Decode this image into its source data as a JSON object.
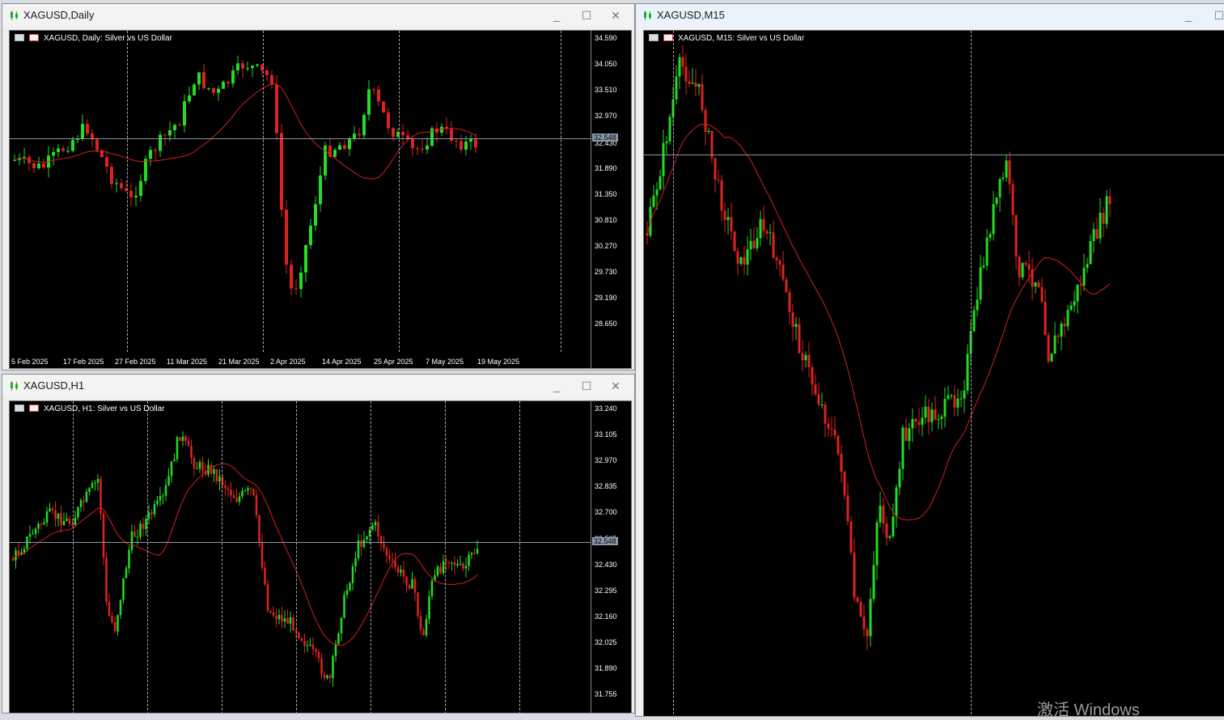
{
  "colors": {
    "bull": "#22dd22",
    "bear": "#dd2222",
    "ma": "#d42020",
    "bg": "#000000"
  },
  "windows": {
    "daily": {
      "title": "XAGUSD,Daily",
      "label": "XAGUSD, Daily:  Silver vs US Dollar",
      "price_tag": "32.548",
      "axis_ticks": [
        "34.590",
        "34.050",
        "33.510",
        "32.970",
        "32.430",
        "31.890",
        "31.350",
        "30.810",
        "30.270",
        "29.730",
        "29.190",
        "28.650"
      ],
      "date_labels": [
        "5 Feb 2025",
        "17 Feb 2025",
        "27 Feb 2025",
        "11 Mar 2025",
        "21 Mar 2025",
        "2 Apr 2025",
        "14 Apr 2025",
        "25 Apr 2025",
        "7 May 2025",
        "19 May 2025"
      ]
    },
    "h1": {
      "title": "XAGUSD,H1",
      "label": "XAGUSD, H1:  Silver vs US Dollar",
      "price_tag": "32.548",
      "axis_ticks": [
        "33.240",
        "33.105",
        "32.970",
        "32.835",
        "32.700",
        "32.565",
        "32.430",
        "32.295",
        "32.160",
        "32.025",
        "31.890",
        "31.755"
      ]
    },
    "m15": {
      "title": "XAGUSD,M15",
      "label": "XAGUSD, M15:  Silver vs US Dollar"
    }
  },
  "watermark": "激活 Windows"
}
